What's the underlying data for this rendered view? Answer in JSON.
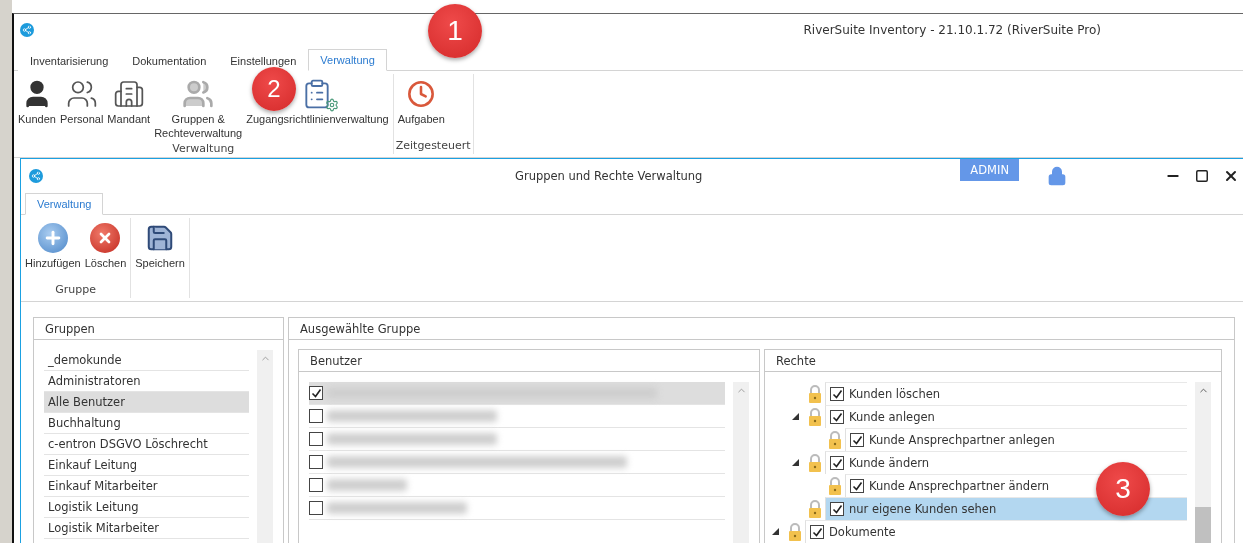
{
  "window": {
    "title": "RiverSuite Inventory - 21.10.1.72 (RiverSuite Pro)"
  },
  "tabs": [
    {
      "label": "Inventarisierung",
      "selected": false
    },
    {
      "label": "Dokumentation",
      "selected": false
    },
    {
      "label": "Einstellungen",
      "selected": false
    },
    {
      "label": "Verwaltung",
      "selected": true
    }
  ],
  "ribbon": {
    "groups": [
      {
        "label": "Verwaltung",
        "buttons": [
          "Kunden",
          "Personal",
          "Mandant",
          "Gruppen &\nRechteverwaltung",
          "Zugangsrichtlinienverwaltung"
        ]
      },
      {
        "label": "Zeitgesteuert",
        "buttons": [
          "Aufgaben"
        ]
      }
    ]
  },
  "dialog": {
    "title": "Gruppen und Rechte Verwaltung",
    "role_badge": "ADMIN",
    "tabs": [
      {
        "label": "Verwaltung",
        "selected": true
      }
    ],
    "ribbon": {
      "groups": [
        {
          "label": "Gruppe",
          "buttons": [
            "Hinzufügen",
            "Löschen"
          ]
        },
        {
          "buttons": [
            "Speichern"
          ]
        }
      ]
    },
    "groups_panel": {
      "title": "Gruppen",
      "items": [
        {
          "label": "_demokunde",
          "selected": false
        },
        {
          "label": "Administratoren",
          "selected": false
        },
        {
          "label": "Alle Benutzer",
          "selected": true
        },
        {
          "label": "Buchhaltung",
          "selected": false
        },
        {
          "label": "c-entron DSGVO Löschrecht",
          "selected": false
        },
        {
          "label": "Einkauf Leitung",
          "selected": false
        },
        {
          "label": "Einkauf Mitarbeiter",
          "selected": false
        },
        {
          "label": "Logistik Leitung",
          "selected": false
        },
        {
          "label": "Logistik Mitarbeiter",
          "selected": false
        }
      ]
    },
    "selected_group": {
      "title": "Ausgewählte Gruppe",
      "users": {
        "title": "Benutzer",
        "items": [
          {
            "checked": true,
            "selected": true
          },
          {
            "checked": false,
            "selected": false
          },
          {
            "checked": false,
            "selected": false
          },
          {
            "checked": false,
            "selected": false
          },
          {
            "checked": false,
            "selected": false
          },
          {
            "checked": false,
            "selected": false
          }
        ]
      },
      "rights": {
        "title": "Rechte",
        "items": [
          {
            "children": [
              {
                "label": "Kunden löschen",
                "checked": true,
                "selected": false
              },
              {
                "label": "Kunde anlegen",
                "checked": true,
                "selected": false,
                "expanded": true,
                "children": [
                  {
                    "label": "Kunde Ansprechpartner anlegen",
                    "checked": true,
                    "selected": false
                  }
                ]
              },
              {
                "label": "Kunde ändern",
                "checked": true,
                "selected": false,
                "expanded": true,
                "children": [
                  {
                    "label": "Kunde Ansprechpartner ändern",
                    "checked": true,
                    "selected": false
                  }
                ]
              },
              {
                "label": "nur eigene Kunden sehen",
                "checked": true,
                "selected": true
              }
            ]
          },
          {
            "label": "Dokumente",
            "checked": true,
            "selected": false,
            "expanded": true
          }
        ]
      }
    }
  },
  "markers": [
    "1",
    "2",
    "3"
  ]
}
